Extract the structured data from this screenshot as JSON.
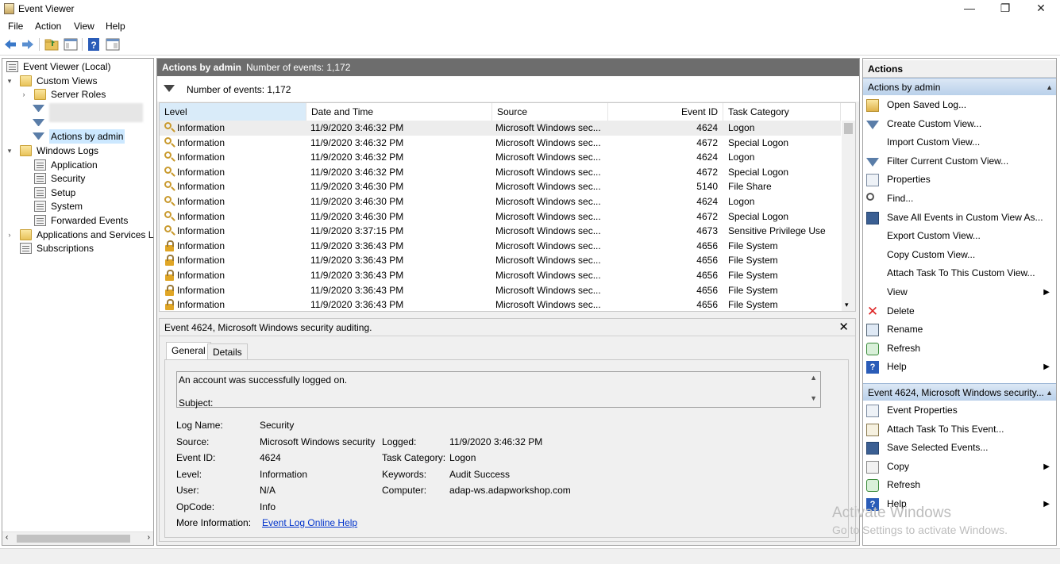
{
  "window": {
    "title": "Event Viewer",
    "minimize": "—",
    "restore": "❐",
    "close": "✕"
  },
  "menu": [
    "File",
    "Action",
    "View",
    "Help"
  ],
  "tree": {
    "root": "Event Viewer (Local)",
    "custom_views": "Custom Views",
    "server_roles": "Server Roles",
    "actions_by_admin": "Actions by admin",
    "windows_logs": "Windows Logs",
    "application": "Application",
    "security": "Security",
    "setup": "Setup",
    "system": "System",
    "forwarded_events": "Forwarded Events",
    "apps_services": "Applications and Services Lo",
    "subscriptions": "Subscriptions"
  },
  "middle": {
    "header_title": "Actions by admin",
    "header_count": "Number of events: 1,172",
    "filter_text": "Number of events: 1,172"
  },
  "grid": {
    "columns": [
      "Level",
      "Date and Time",
      "Source",
      "Event ID",
      "Task Category"
    ],
    "rows": [
      {
        "icon": "key",
        "level": "Information",
        "date": "11/9/2020 3:46:32 PM",
        "source": "Microsoft Windows sec...",
        "id": "4624",
        "cat": "Logon"
      },
      {
        "icon": "key",
        "level": "Information",
        "date": "11/9/2020 3:46:32 PM",
        "source": "Microsoft Windows sec...",
        "id": "4672",
        "cat": "Special Logon"
      },
      {
        "icon": "key",
        "level": "Information",
        "date": "11/9/2020 3:46:32 PM",
        "source": "Microsoft Windows sec...",
        "id": "4624",
        "cat": "Logon"
      },
      {
        "icon": "key",
        "level": "Information",
        "date": "11/9/2020 3:46:32 PM",
        "source": "Microsoft Windows sec...",
        "id": "4672",
        "cat": "Special Logon"
      },
      {
        "icon": "key",
        "level": "Information",
        "date": "11/9/2020 3:46:30 PM",
        "source": "Microsoft Windows sec...",
        "id": "5140",
        "cat": "File Share"
      },
      {
        "icon": "key",
        "level": "Information",
        "date": "11/9/2020 3:46:30 PM",
        "source": "Microsoft Windows sec...",
        "id": "4624",
        "cat": "Logon"
      },
      {
        "icon": "key",
        "level": "Information",
        "date": "11/9/2020 3:46:30 PM",
        "source": "Microsoft Windows sec...",
        "id": "4672",
        "cat": "Special Logon"
      },
      {
        "icon": "key",
        "level": "Information",
        "date": "11/9/2020 3:37:15 PM",
        "source": "Microsoft Windows sec...",
        "id": "4673",
        "cat": "Sensitive Privilege Use"
      },
      {
        "icon": "lock",
        "level": "Information",
        "date": "11/9/2020 3:36:43 PM",
        "source": "Microsoft Windows sec...",
        "id": "4656",
        "cat": "File System"
      },
      {
        "icon": "lock",
        "level": "Information",
        "date": "11/9/2020 3:36:43 PM",
        "source": "Microsoft Windows sec...",
        "id": "4656",
        "cat": "File System"
      },
      {
        "icon": "lock",
        "level": "Information",
        "date": "11/9/2020 3:36:43 PM",
        "source": "Microsoft Windows sec...",
        "id": "4656",
        "cat": "File System"
      },
      {
        "icon": "lock",
        "level": "Information",
        "date": "11/9/2020 3:36:43 PM",
        "source": "Microsoft Windows sec...",
        "id": "4656",
        "cat": "File System"
      },
      {
        "icon": "lock",
        "level": "Information",
        "date": "11/9/2020 3:36:43 PM",
        "source": "Microsoft Windows sec...",
        "id": "4656",
        "cat": "File System"
      }
    ]
  },
  "detail": {
    "title": "Event 4624, Microsoft Windows security auditing.",
    "close": "✕",
    "tabs": [
      "General",
      "Details"
    ],
    "message_line1": "An account was successfully logged on.",
    "message_line2": "Subject:",
    "fields": {
      "log_name_label": "Log Name:",
      "log_name": "Security",
      "source_label": "Source:",
      "source": "Microsoft Windows security",
      "logged_label": "Logged:",
      "logged": "11/9/2020 3:46:32 PM",
      "event_id_label": "Event ID:",
      "event_id": "4624",
      "task_category_label": "Task Category:",
      "task_category": "Logon",
      "level_label": "Level:",
      "level": "Information",
      "keywords_label": "Keywords:",
      "keywords": "Audit Success",
      "user_label": "User:",
      "user": "N/A",
      "computer_label": "Computer:",
      "computer": "adap-ws.adapworkshop.com",
      "opcode_label": "OpCode:",
      "opcode": "Info",
      "more_info_label": "More Information:",
      "more_info_link": "Event Log Online Help"
    }
  },
  "actions": {
    "header": "Actions",
    "section1": "Actions by admin",
    "items1": [
      {
        "icon": "open",
        "label": "Open Saved Log..."
      },
      {
        "icon": "filter",
        "label": "Create Custom View..."
      },
      {
        "icon": "none",
        "label": "Import Custom View..."
      },
      {
        "icon": "filter",
        "label": "Filter Current Custom View..."
      },
      {
        "icon": "prop",
        "label": "Properties"
      },
      {
        "icon": "find",
        "label": "Find..."
      },
      {
        "icon": "save",
        "label": "Save All Events in Custom View As..."
      },
      {
        "icon": "none",
        "label": "Export Custom View..."
      },
      {
        "icon": "none",
        "label": "Copy Custom View..."
      },
      {
        "icon": "none",
        "label": "Attach Task To This Custom View..."
      },
      {
        "icon": "none",
        "label": "View",
        "sub": true
      },
      {
        "icon": "del",
        "label": "Delete"
      },
      {
        "icon": "ren",
        "label": "Rename"
      },
      {
        "icon": "ref",
        "label": "Refresh"
      },
      {
        "icon": "help",
        "label": "Help",
        "sub": true
      }
    ],
    "section2": "Event 4624, Microsoft Windows security...",
    "items2": [
      {
        "icon": "prop",
        "label": "Event Properties"
      },
      {
        "icon": "task",
        "label": "Attach Task To This Event..."
      },
      {
        "icon": "save",
        "label": "Save Selected Events..."
      },
      {
        "icon": "copy",
        "label": "Copy",
        "sub": true
      },
      {
        "icon": "ref",
        "label": "Refresh"
      },
      {
        "icon": "help",
        "label": "Help",
        "sub": true
      }
    ]
  },
  "watermark": {
    "line1": "Activate Windows",
    "line2": "Go to Settings to activate Windows."
  }
}
